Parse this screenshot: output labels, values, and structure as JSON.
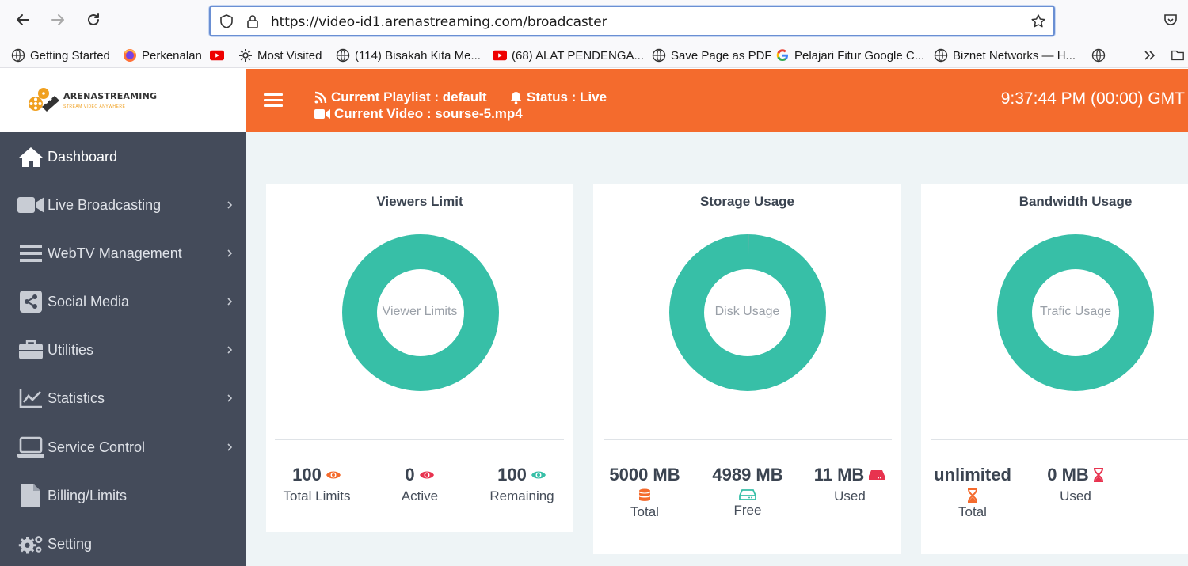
{
  "browser": {
    "url": "https://video-id1.arenastreaming.com/broadcaster",
    "bookmarks": [
      {
        "label": "Getting Started",
        "icon": "firefox-globe-icon"
      },
      {
        "label": "Perkenalan",
        "icon": "firefox-icon"
      },
      {
        "label": "",
        "icon": "youtube-icon"
      },
      {
        "label": "Most Visited",
        "icon": "gear-icon"
      },
      {
        "label": "(114) Bisakah Kita Me...",
        "icon": "globe-icon"
      },
      {
        "label": "(68) ALAT PENDENGA...",
        "icon": "youtube-icon"
      },
      {
        "label": "Save Page as PDF",
        "icon": "globe-icon"
      },
      {
        "label": "Pelajari Fitur Google C...",
        "icon": "google-icon"
      },
      {
        "label": "Biznet Networks — H...",
        "icon": "globe-icon"
      }
    ]
  },
  "brand": {
    "name": "ARENASTREAMING",
    "tagline": "STREAM VIDEO ANYWHERE"
  },
  "header": {
    "playlist": "Current Playlist : default",
    "status": "Status : Live",
    "video": "Current Video : sourse-5.mp4",
    "clock": "9:37:44 PM (00:00) GMT",
    "accent": "#f46b2d"
  },
  "sidebar": {
    "items": [
      {
        "label": "Dashboard",
        "icon": "home-icon",
        "chevron": false
      },
      {
        "label": "Live Broadcasting",
        "icon": "video-camera-icon",
        "chevron": true
      },
      {
        "label": "WebTV Management",
        "icon": "menu-bars-icon",
        "chevron": true
      },
      {
        "label": "Social Media",
        "icon": "share-icon",
        "chevron": true
      },
      {
        "label": "Utilities",
        "icon": "briefcase-icon",
        "chevron": true
      },
      {
        "label": "Statistics",
        "icon": "line-chart-icon",
        "chevron": true
      },
      {
        "label": "Service Control",
        "icon": "laptop-icon",
        "chevron": true
      },
      {
        "label": "Billing/Limits",
        "icon": "file-icon",
        "chevron": false
      },
      {
        "label": "Setting",
        "icon": "gears-icon",
        "chevron": false
      }
    ]
  },
  "cards": {
    "viewers": {
      "title": "Viewers Limit",
      "donut_label": "Viewer Limits",
      "stats": [
        {
          "value": "100",
          "label": "Total Limits",
          "icon": "eye-icon",
          "color": "#f46b2d"
        },
        {
          "value": "0",
          "label": "Active",
          "icon": "eye-icon",
          "color": "#e8334f"
        },
        {
          "value": "100",
          "label": "Remaining",
          "icon": "eye-icon",
          "color": "#37bfa7"
        }
      ]
    },
    "storage": {
      "title": "Storage Usage",
      "donut_label": "Disk Usage",
      "used_fraction": 0.0022,
      "stats": [
        {
          "value": "5000 MB",
          "label": "Total",
          "icon": "database-icon",
          "color": "#f46b2d"
        },
        {
          "value": "4989 MB",
          "label": "Free",
          "icon": "hdd-icon",
          "color": "#37bfa7"
        },
        {
          "value": "11 MB",
          "label": "Used",
          "icon": "hdd-icon",
          "color": "#e8334f"
        }
      ]
    },
    "bandwidth": {
      "title": "Bandwidth Usage",
      "donut_label": "Trafic Usage",
      "stats": [
        {
          "value": "unlimited",
          "label": "Total",
          "icon": "hourglass-icon",
          "color": "#f46b2d"
        },
        {
          "value": "0 MB",
          "label": "Used",
          "icon": "hourglass-icon",
          "color": "#e8334f"
        }
      ]
    },
    "donut_color": "#37bfa7",
    "used_color": "#9aa0a8"
  }
}
